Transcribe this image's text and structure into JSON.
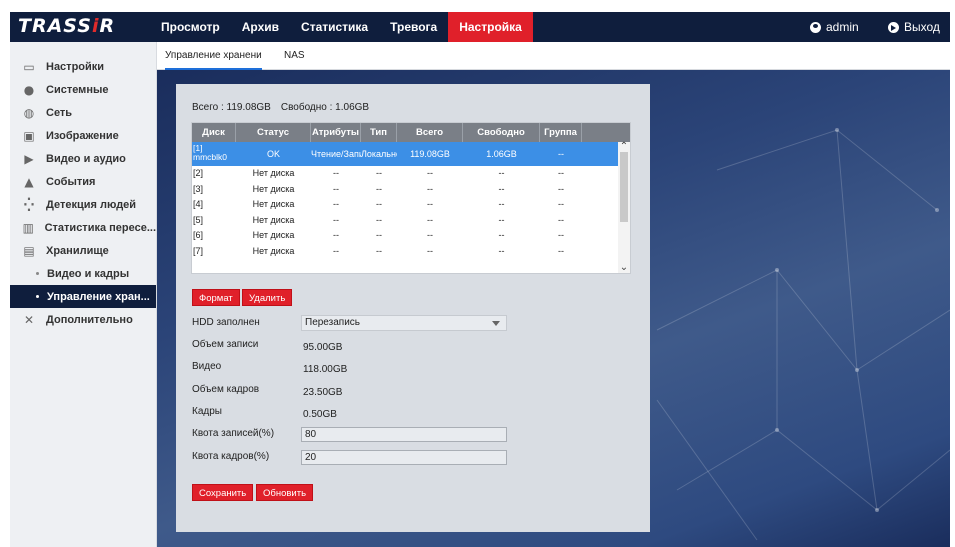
{
  "app": {
    "logo": "TRASSIR"
  },
  "nav": {
    "items": [
      {
        "label": "Просмотр"
      },
      {
        "label": "Архив"
      },
      {
        "label": "Статистика"
      },
      {
        "label": "Тревога"
      },
      {
        "label": "Настройка"
      }
    ],
    "user": "admin",
    "logout": "Выход"
  },
  "sidebar": {
    "items": [
      {
        "label": "Настройки",
        "icon": "monitor-icon"
      },
      {
        "label": "Системные",
        "icon": "info-icon"
      },
      {
        "label": "Сеть",
        "icon": "globe-icon"
      },
      {
        "label": "Изображение",
        "icon": "image-icon"
      },
      {
        "label": "Видео и аудио",
        "icon": "video-icon"
      },
      {
        "label": "События",
        "icon": "bell-icon"
      },
      {
        "label": "Детекция людей",
        "icon": "person-detection-icon"
      },
      {
        "label": "Статистика пересе...",
        "icon": "chart-icon"
      },
      {
        "label": "Хранилище",
        "icon": "save-icon"
      }
    ],
    "sub_items": [
      {
        "label": "Видео и кадры"
      },
      {
        "label": "Управление хран..."
      }
    ],
    "extra": {
      "label": "Дополнительно",
      "icon": "tools-icon"
    }
  },
  "subtabs": [
    {
      "label": "Управление хранени"
    },
    {
      "label": "NAS"
    }
  ],
  "totals": {
    "total": "Всего : 119.08GB",
    "free": "Свободно : 1.06GB"
  },
  "table": {
    "headers": [
      "Диск",
      "Статус",
      "Атрибуты",
      "Тип",
      "Всего",
      "Свободно",
      "Группа"
    ],
    "rows": [
      [
        "[1] mmcblk0",
        "OK",
        "Чтение/Запись",
        "Локально",
        "119.08GB",
        "1.06GB",
        "--"
      ],
      [
        "[2]",
        "Нет диска",
        "--",
        "--",
        "--",
        "--",
        "--"
      ],
      [
        "[3]",
        "Нет диска",
        "--",
        "--",
        "--",
        "--",
        "--"
      ],
      [
        "[4]",
        "Нет диска",
        "--",
        "--",
        "--",
        "--",
        "--"
      ],
      [
        "[5]",
        "Нет диска",
        "--",
        "--",
        "--",
        "--",
        "--"
      ],
      [
        "[6]",
        "Нет диска",
        "--",
        "--",
        "--",
        "--",
        "--"
      ],
      [
        "[7]",
        "Нет диска",
        "--",
        "--",
        "--",
        "--",
        "--"
      ]
    ]
  },
  "buttons": {
    "format": "Формат",
    "delete": "Удалить",
    "save": "Сохранить",
    "refresh": "Обновить"
  },
  "form": {
    "hdd_full_label": "HDD заполнен",
    "hdd_full_value": "Перезапись",
    "record_volume_label": "Объем записи",
    "record_volume_value": "95.00GB",
    "video_label": "Видео",
    "video_value": "118.00GB",
    "frames_volume_label": "Объем кадров",
    "frames_volume_value": "23.50GB",
    "frames_label": "Кадры",
    "frames_value": "0.50GB",
    "record_quota_label": "Квота записей(%)",
    "record_quota_value": "80",
    "frames_quota_label": "Квота кадров(%)",
    "frames_quota_value": "20"
  }
}
